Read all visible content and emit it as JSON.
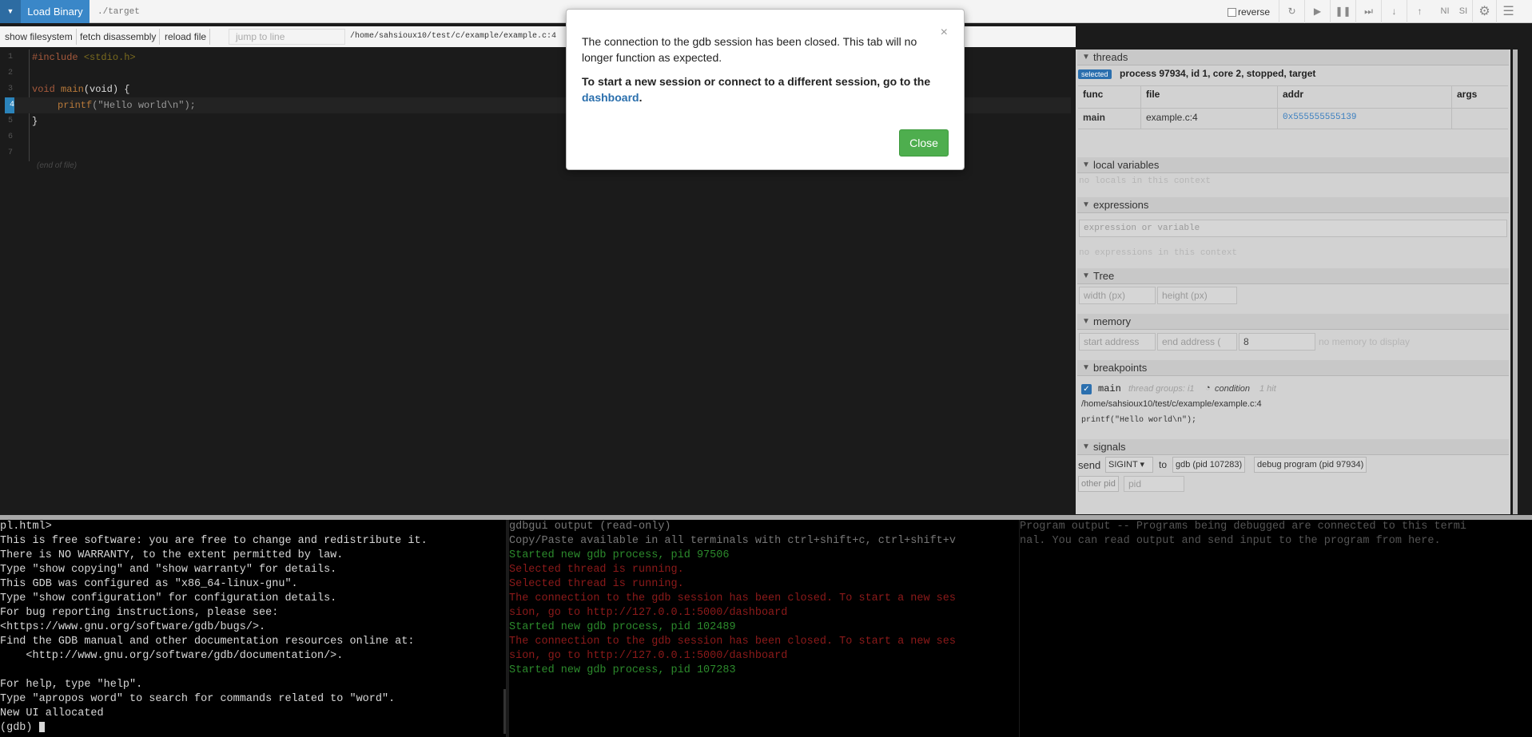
{
  "toolbar": {
    "load_binary_label": "Load Binary",
    "binary_placeholder": "./target",
    "reverse_label": "reverse",
    "ni_label": "NI",
    "si_label": "SI"
  },
  "subbar": {
    "show_filesystem": "show filesystem",
    "fetch_disassembly": "fetch disassembly",
    "reload_file": "reload file",
    "jump_placeholder": "jump to line",
    "file_path": "/home/sahsioux10/test/c/example/example.c:4"
  },
  "code": {
    "line_numbers": [
      "1",
      "2",
      "3",
      "4",
      "5",
      "6",
      "7"
    ],
    "include_kw": "#include",
    "include_target": "<stdio.h>",
    "void_kw": "void",
    "main_fn": "main",
    "main_params": "(void) {",
    "printf_fn": "printf",
    "printf_args": "(\"Hello world\\n\");",
    "closing_brace": "}",
    "eof_label": "(end of file)"
  },
  "threads": {
    "header": "threads",
    "badge": "selected",
    "process": "process 97934, id 1, core 2, stopped, target",
    "columns": [
      "func",
      "file",
      "addr",
      "args"
    ],
    "row": {
      "func": "main",
      "file": "example.c:4",
      "addr": "0x555555555139",
      "args": ""
    }
  },
  "locals": {
    "header": "local variables",
    "empty": "no locals in this context"
  },
  "expressions": {
    "header": "expressions",
    "placeholder": "expression or variable",
    "empty": "no expressions in this context"
  },
  "tree": {
    "header": "Tree",
    "width_placeholder": "width (px)",
    "height_placeholder": "height (px)"
  },
  "memory": {
    "header": "memory",
    "start_placeholder": "start address",
    "end_placeholder": "end address (",
    "lines_value": "8",
    "empty": "no memory to display"
  },
  "breakpoints": {
    "header": "breakpoints",
    "func": "main",
    "thread_groups": "thread groups: i1",
    "condition": "condition",
    "hit": "1 hit",
    "path": "/home/sahsioux10/test/c/example/example.c:4",
    "source": "printf(\"Hello world\\n\");"
  },
  "signals": {
    "header": "signals",
    "send_label": "send",
    "signal_value": "SIGINT",
    "to_label": "to",
    "gdb_pid_label": "gdb (pid 107283)",
    "debug_program_label": "debug program (pid 97934)",
    "other_pid_label": "other pid",
    "pid_placeholder": "pid"
  },
  "terminal_gdb": {
    "lines": [
      "pl.html>",
      "This is free software: you are free to change and redistribute it.",
      "There is NO WARRANTY, to the extent permitted by law.",
      "Type \"show copying\" and \"show warranty\" for details.",
      "This GDB was configured as \"x86_64-linux-gnu\".",
      "Type \"show configuration\" for configuration details.",
      "For bug reporting instructions, please see:",
      "<https://www.gnu.org/software/gdb/bugs/>.",
      "Find the GDB manual and other documentation resources online at:",
      "    <http://www.gnu.org/software/gdb/documentation/>.",
      "",
      "For help, type \"help\".",
      "Type \"apropos word\" to search for commands related to \"word\".",
      "New UI allocated"
    ],
    "prompt": "(gdb) "
  },
  "terminal_gdbgui": {
    "title": "gdbgui output (read-only)",
    "hint": "Copy/Paste available in all terminals with ctrl+shift+c, ctrl+shift+v",
    "lines": [
      {
        "text": "Started new gdb process, pid 97506",
        "color": "green"
      },
      {
        "text": "Selected thread is running.",
        "color": "red"
      },
      {
        "text": "Selected thread is running.",
        "color": "red"
      },
      {
        "text": "The connection to the gdb session has been closed. To start a new ses",
        "color": "red"
      },
      {
        "text": "sion, go to http://127.0.0.1:5000/dashboard",
        "color": "red"
      },
      {
        "text": "Started new gdb process, pid 102489",
        "color": "green"
      },
      {
        "text": "The connection to the gdb session has been closed. To start a new ses",
        "color": "red"
      },
      {
        "text": "sion, go to http://127.0.0.1:5000/dashboard",
        "color": "red"
      },
      {
        "text": "Started new gdb process, pid 107283",
        "color": "green"
      }
    ]
  },
  "terminal_program": {
    "lines": [
      "Program output -- Programs being debugged are connected to this termi",
      "nal. You can read output and send input to the program from here."
    ]
  },
  "modal": {
    "paragraph1": "The connection to the gdb session has been closed. This tab will no longer function as expected.",
    "paragraph2_prefix": "To start a new session or connect to a different session, go to the",
    "dashboard_link": "dashboard",
    "paragraph2_suffix": ".",
    "close_label": "Close"
  }
}
